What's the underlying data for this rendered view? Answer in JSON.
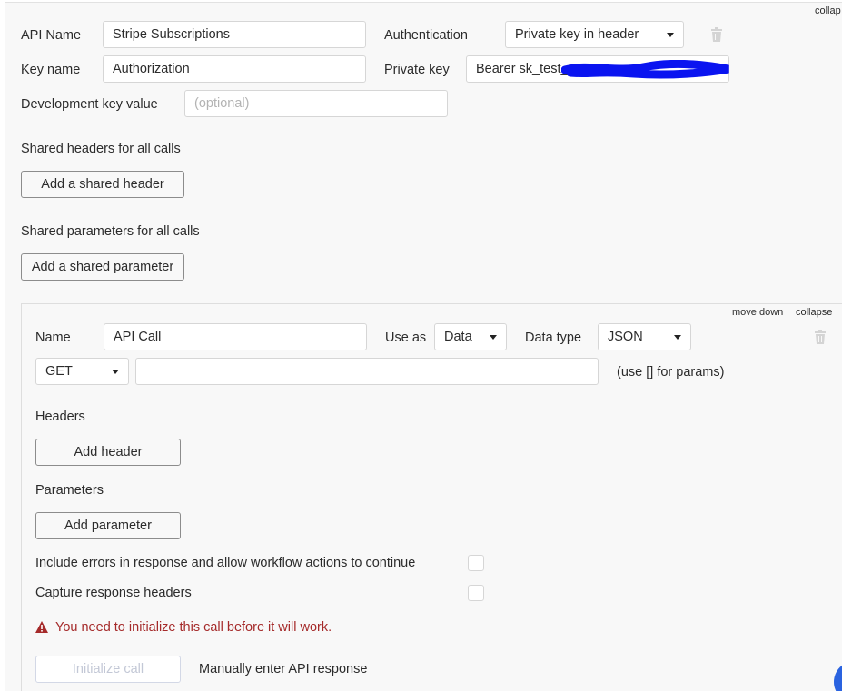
{
  "top": {
    "collapse_label": "collap"
  },
  "api": {
    "api_name_label": "API Name",
    "api_name_value": "Stripe Subscriptions",
    "authentication_label": "Authentication",
    "authentication_value": "Private key in header",
    "key_name_label": "Key name",
    "key_name_value": "Authorization",
    "private_key_label": "Private key",
    "private_key_value": "Bearer sk_test_51",
    "dev_key_label": "Development key value",
    "dev_key_placeholder": "(optional)"
  },
  "shared_headers": {
    "title": "Shared headers for all calls",
    "button": "Add a shared header"
  },
  "shared_params": {
    "title": "Shared parameters for all calls",
    "button": "Add a shared parameter"
  },
  "call": {
    "move_down": "move down",
    "collapse": "collapse",
    "name_label": "Name",
    "name_value": "API Call",
    "use_as_label": "Use as",
    "use_as_value": "Data",
    "data_type_label": "Data type",
    "data_type_value": "JSON",
    "method_value": "GET",
    "url_value": "",
    "url_hint": "(use [] for params)",
    "headers_title": "Headers",
    "add_header": "Add header",
    "parameters_title": "Parameters",
    "add_parameter": "Add parameter",
    "include_errors_label": "Include errors in response and allow workflow actions to continue",
    "capture_headers_label": "Capture response headers",
    "warning": "You need to initialize this call before it will work.",
    "initialize_button": "Initialize call",
    "manual_response": "Manually enter API response"
  },
  "colors": {
    "warning": "#a52a2a",
    "redaction": "#0a14f0",
    "accent": "#2a63e0"
  }
}
